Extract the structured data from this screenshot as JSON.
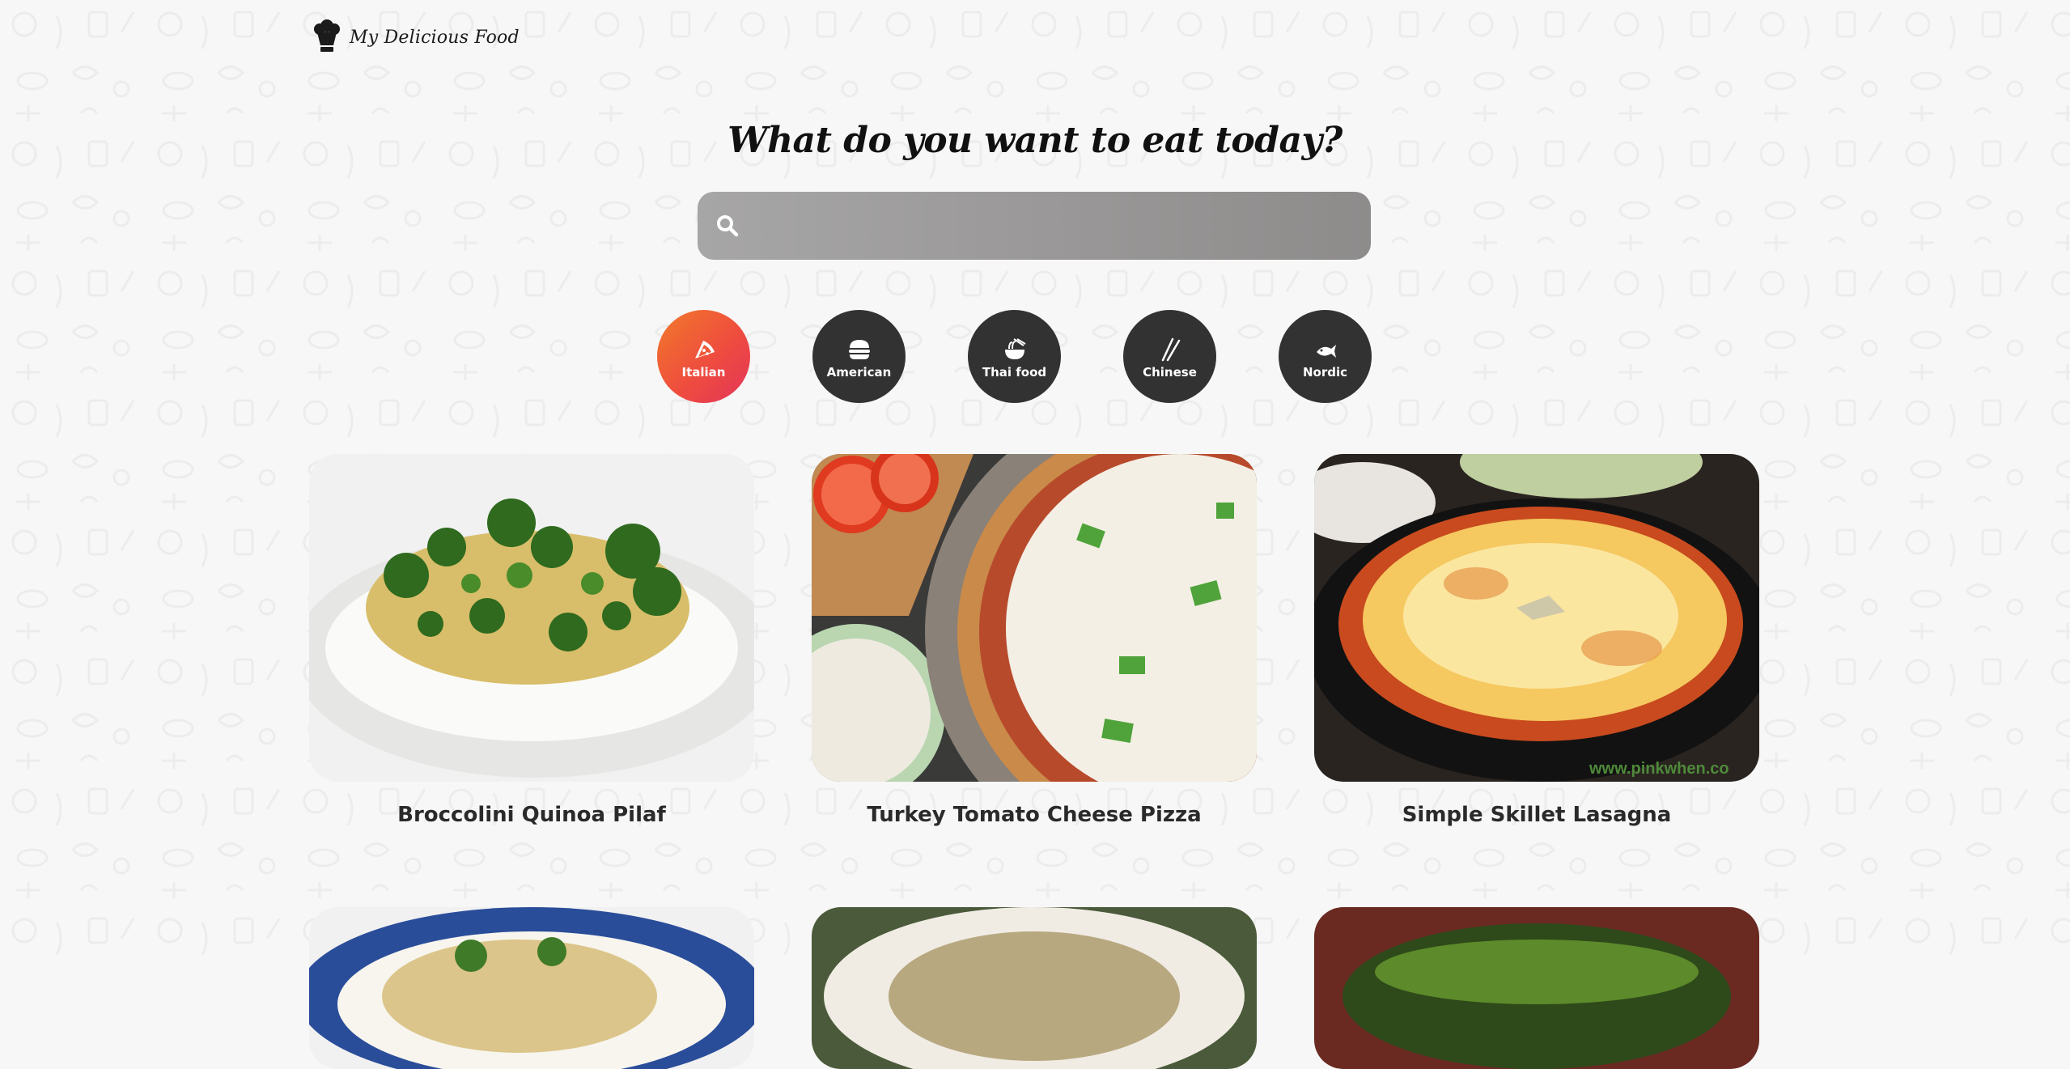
{
  "header": {
    "logo_text": "My Delicious Food"
  },
  "hero": {
    "headline": "What do you want to eat today?"
  },
  "search": {
    "placeholder": "",
    "value": ""
  },
  "categories": [
    {
      "label": "Italian",
      "icon": "pizza-icon",
      "active": true
    },
    {
      "label": "American",
      "icon": "burger-icon",
      "active": false
    },
    {
      "label": "Thai food",
      "icon": "noodle-bowl-icon",
      "active": false
    },
    {
      "label": "Chinese",
      "icon": "chopsticks-icon",
      "active": false
    },
    {
      "label": "Nordic",
      "icon": "fish-icon",
      "active": false
    }
  ],
  "recipes": [
    {
      "title": "Broccolini Quinoa Pilaf"
    },
    {
      "title": "Turkey Tomato Cheese Pizza"
    },
    {
      "title": "Simple Skillet Lasagna"
    },
    {
      "title": ""
    },
    {
      "title": ""
    },
    {
      "title": ""
    }
  ],
  "image_watermark": "www.pinkwhen.co",
  "colors": {
    "accent_gradient_start": "#f07a2a",
    "accent_gradient_end": "#e3345a",
    "category_bg": "#323232",
    "search_bg": "#9b9a9a"
  }
}
